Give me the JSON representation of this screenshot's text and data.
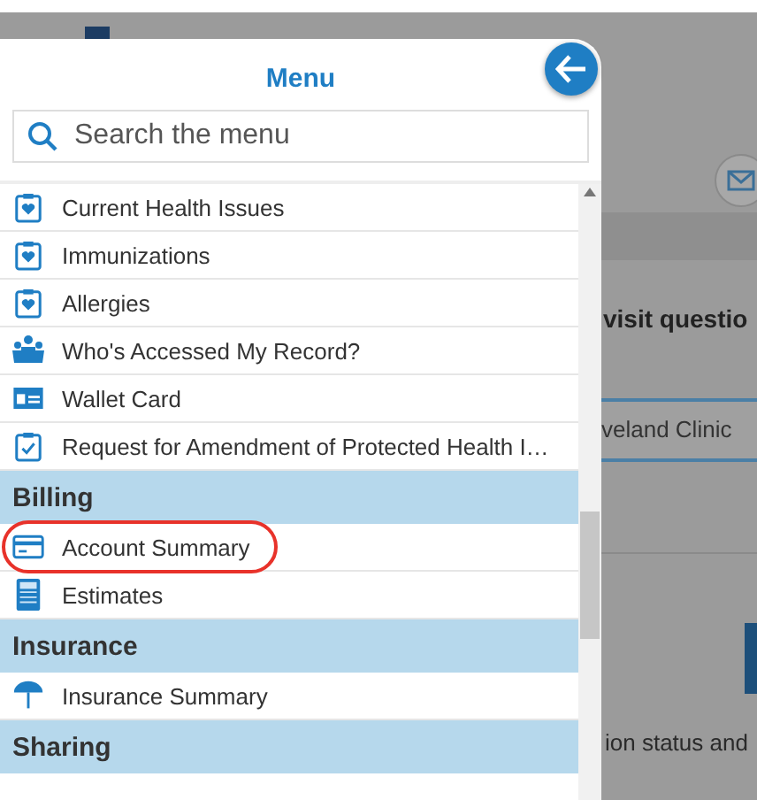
{
  "background_page": {
    "heading": "visit questio",
    "field_value": "veland Clinic",
    "body_text": "ion status and"
  },
  "menu": {
    "title": "Menu",
    "search": {
      "placeholder": "Search the menu"
    },
    "items": [
      {
        "kind": "item",
        "label": "Current Health Issues",
        "circled": false
      },
      {
        "kind": "item",
        "label": "Immunizations",
        "circled": false
      },
      {
        "kind": "item",
        "label": "Allergies",
        "circled": false
      },
      {
        "kind": "item",
        "label": "Who's Accessed My Record?",
        "circled": false
      },
      {
        "kind": "item",
        "label": "Wallet Card",
        "circled": false
      },
      {
        "kind": "item",
        "label": "Request for Amendment of Protected Health I…",
        "circled": false
      },
      {
        "kind": "header",
        "label": "Billing"
      },
      {
        "kind": "item",
        "label": "Account Summary",
        "circled": true
      },
      {
        "kind": "item",
        "label": "Estimates",
        "circled": false
      },
      {
        "kind": "header",
        "label": "Insurance"
      },
      {
        "kind": "item",
        "label": "Insurance Summary",
        "circled": false
      },
      {
        "kind": "header",
        "label": "Sharing"
      }
    ]
  }
}
